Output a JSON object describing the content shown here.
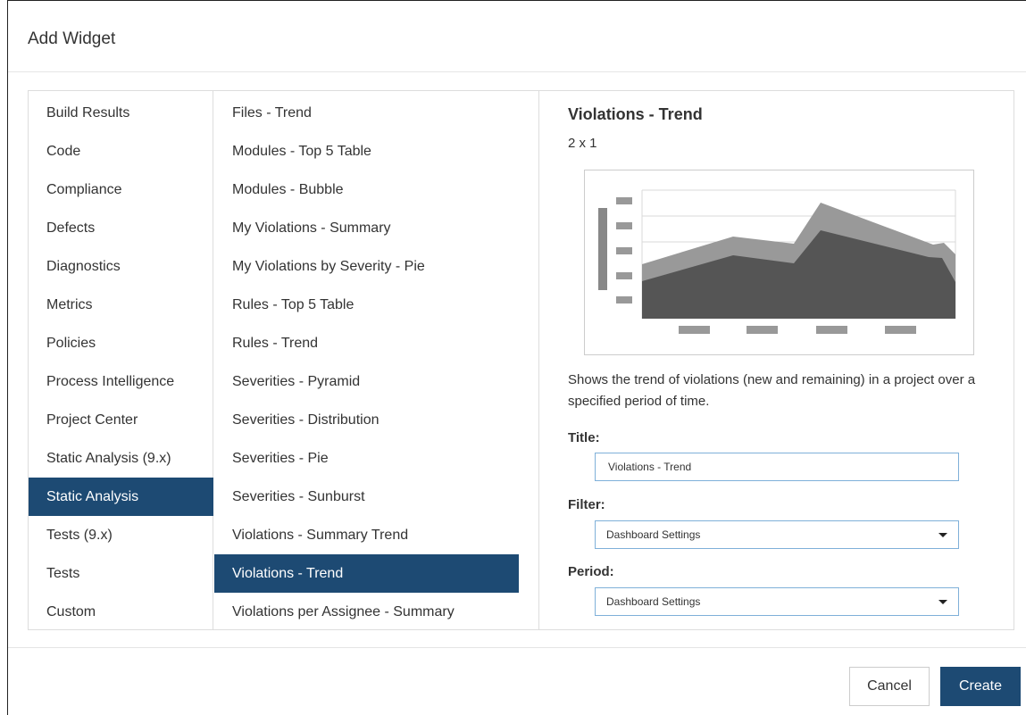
{
  "dialog": {
    "title": "Add Widget"
  },
  "categories": [
    {
      "label": "Build Results",
      "selected": false
    },
    {
      "label": "Code",
      "selected": false
    },
    {
      "label": "Compliance",
      "selected": false
    },
    {
      "label": "Defects",
      "selected": false
    },
    {
      "label": "Diagnostics",
      "selected": false
    },
    {
      "label": "Metrics",
      "selected": false
    },
    {
      "label": "Policies",
      "selected": false
    },
    {
      "label": "Process Intelligence",
      "selected": false
    },
    {
      "label": "Project Center",
      "selected": false
    },
    {
      "label": "Static Analysis (9.x)",
      "selected": false
    },
    {
      "label": "Static Analysis",
      "selected": true
    },
    {
      "label": "Tests (9.x)",
      "selected": false
    },
    {
      "label": "Tests",
      "selected": false
    },
    {
      "label": "Custom",
      "selected": false
    }
  ],
  "widgets": [
    {
      "label": "Files - Trend",
      "selected": false
    },
    {
      "label": "Modules - Top 5 Table",
      "selected": false
    },
    {
      "label": "Modules - Bubble",
      "selected": false
    },
    {
      "label": "My Violations - Summary",
      "selected": false
    },
    {
      "label": "My Violations by Severity - Pie",
      "selected": false
    },
    {
      "label": "Rules - Top 5 Table",
      "selected": false
    },
    {
      "label": "Rules - Trend",
      "selected": false
    },
    {
      "label": "Severities - Pyramid",
      "selected": false
    },
    {
      "label": "Severities - Distribution",
      "selected": false
    },
    {
      "label": "Severities - Pie",
      "selected": false
    },
    {
      "label": "Severities - Sunburst",
      "selected": false
    },
    {
      "label": "Violations - Summary Trend",
      "selected": false
    },
    {
      "label": "Violations - Trend",
      "selected": true
    },
    {
      "label": "Violations per Assignee - Summary",
      "selected": false
    }
  ],
  "detail": {
    "title": "Violations - Trend",
    "size": "2 x 1",
    "description": "Shows the trend of violations (new and remaining) in a project over a specified period of time.",
    "title_label": "Title:",
    "title_value": "Violations - Trend",
    "filter_label": "Filter:",
    "filter_value": "Dashboard Settings",
    "period_label": "Period:",
    "period_value": "Dashboard Settings"
  },
  "footer": {
    "cancel_label": "Cancel",
    "create_label": "Create"
  },
  "colors": {
    "accent": "#1d4a73",
    "selected_text": "#ffffff",
    "input_border": "#7fb0d9",
    "preview_dark": "#555555",
    "preview_light": "#999999"
  },
  "icons": {
    "scroll_up": "scroll-up-arrow-icon",
    "scroll_down": "scroll-down-arrow-icon",
    "dropdown": "chevron-down-icon"
  }
}
